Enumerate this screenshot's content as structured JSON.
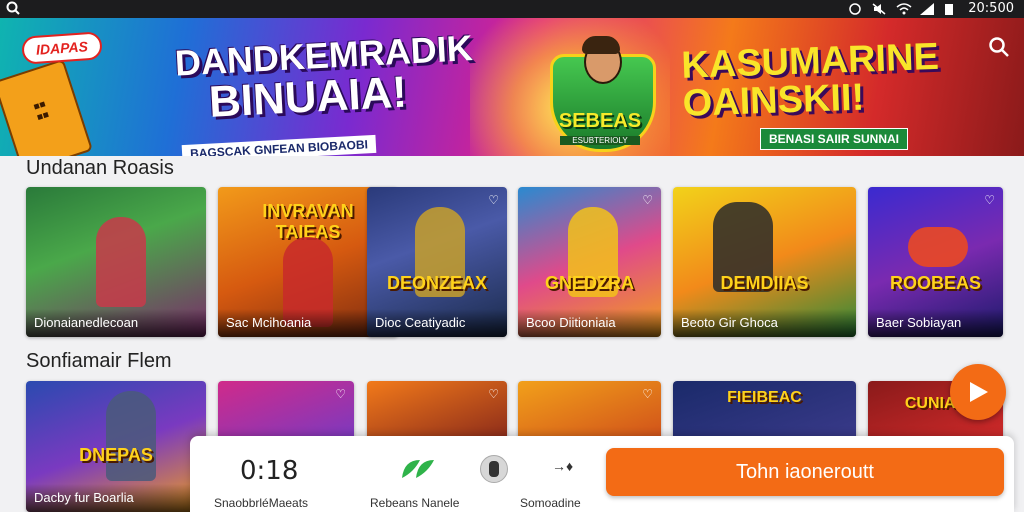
{
  "status_bar": {
    "time": "20:500"
  },
  "banner": {
    "logo": "IDAPAS",
    "headline_left_1": "DANDKEMRADIK",
    "headline_left_2": "BINUAIA!",
    "sub_left": "BAGSCAK GNFEAN BIOBAOBI",
    "badge_title": "SEBEAS",
    "badge_sub": "ESUBTERIOLY",
    "headline_right": "KASUMARINE OAINSKII!",
    "sub_right": "BENASI SAIIR SUNNAI"
  },
  "section1": {
    "title": "Undanan Roasis",
    "cards": [
      {
        "caption": "Dionaianedlecoan",
        "art": ""
      },
      {
        "caption": "Sac Mcihoania",
        "art": "INVRAVAN TAIEAS"
      },
      {
        "caption": "Dioc Ceatiyadic",
        "art": "DEONZEAX"
      },
      {
        "caption": "Bcoo Diitioniaia",
        "art": "GNEDZRA"
      },
      {
        "caption": "Beoto Gir Ghoca",
        "art": "DEMDIIAS"
      },
      {
        "caption": "Baer Sobiayan",
        "art": "ROOBEAS"
      }
    ]
  },
  "section2": {
    "title": "Sonfiamair Flem",
    "cards": [
      {
        "caption": "Dacby fur Boarlia",
        "art": "DNEPAS"
      },
      {
        "caption": "",
        "art": ""
      },
      {
        "caption": "",
        "art": ""
      },
      {
        "caption": "",
        "art": ""
      },
      {
        "caption": "",
        "art": "FIEIBEAC"
      },
      {
        "caption": "",
        "art": "CUNIAS"
      }
    ]
  },
  "bottom_bar": {
    "counter": "0:18",
    "label_1": "SnaobbrléMaeats",
    "label_2": "Rebeans Nanele",
    "label_3": "Somoadine",
    "cta": "Tohn iaoneroutt"
  },
  "colors": {
    "accent": "#f36b15"
  }
}
